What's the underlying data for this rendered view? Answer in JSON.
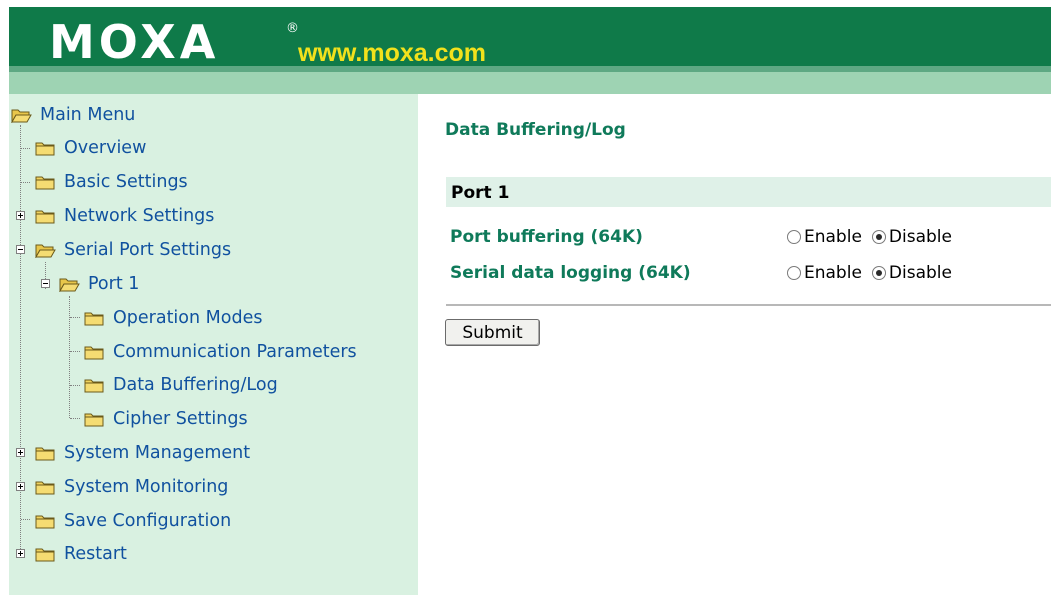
{
  "header": {
    "logo_text": "MOXA",
    "registered_mark": "®",
    "site_url": "www.moxa.com",
    "colors": {
      "band": "#0f7a49",
      "url": "#f2e11c",
      "lower": "#9ed3b3"
    }
  },
  "sidebar": {
    "items": [
      {
        "label": "Main Menu",
        "icon": "open-folder-icon"
      },
      {
        "label": "Overview",
        "icon": "folder-icon"
      },
      {
        "label": "Basic Settings",
        "icon": "folder-icon"
      },
      {
        "label": "Network Settings",
        "icon": "folder-icon",
        "expander": "plus"
      },
      {
        "label": "Serial Port Settings",
        "icon": "open-folder-icon",
        "expander": "minus"
      },
      {
        "label": "Port 1",
        "icon": "open-folder-icon",
        "expander": "minus"
      },
      {
        "label": "Operation Modes",
        "icon": "folder-icon"
      },
      {
        "label": "Communication Parameters",
        "icon": "folder-icon"
      },
      {
        "label": "Data Buffering/Log",
        "icon": "folder-icon"
      },
      {
        "label": "Cipher Settings",
        "icon": "folder-icon"
      },
      {
        "label": "System Management",
        "icon": "folder-icon",
        "expander": "plus"
      },
      {
        "label": "System Monitoring",
        "icon": "folder-icon",
        "expander": "plus"
      },
      {
        "label": "Save Configuration",
        "icon": "folder-icon"
      },
      {
        "label": "Restart",
        "icon": "folder-icon",
        "expander": "plus"
      }
    ]
  },
  "main": {
    "title": "Data Buffering/Log",
    "section_title": "Port 1",
    "settings": [
      {
        "label": "Port buffering (64K)",
        "enable_label": "Enable",
        "disable_label": "Disable",
        "selected": "Disable"
      },
      {
        "label": "Serial data logging (64K)",
        "enable_label": "Enable",
        "disable_label": "Disable",
        "selected": "Disable"
      }
    ],
    "submit_label": "Submit"
  }
}
